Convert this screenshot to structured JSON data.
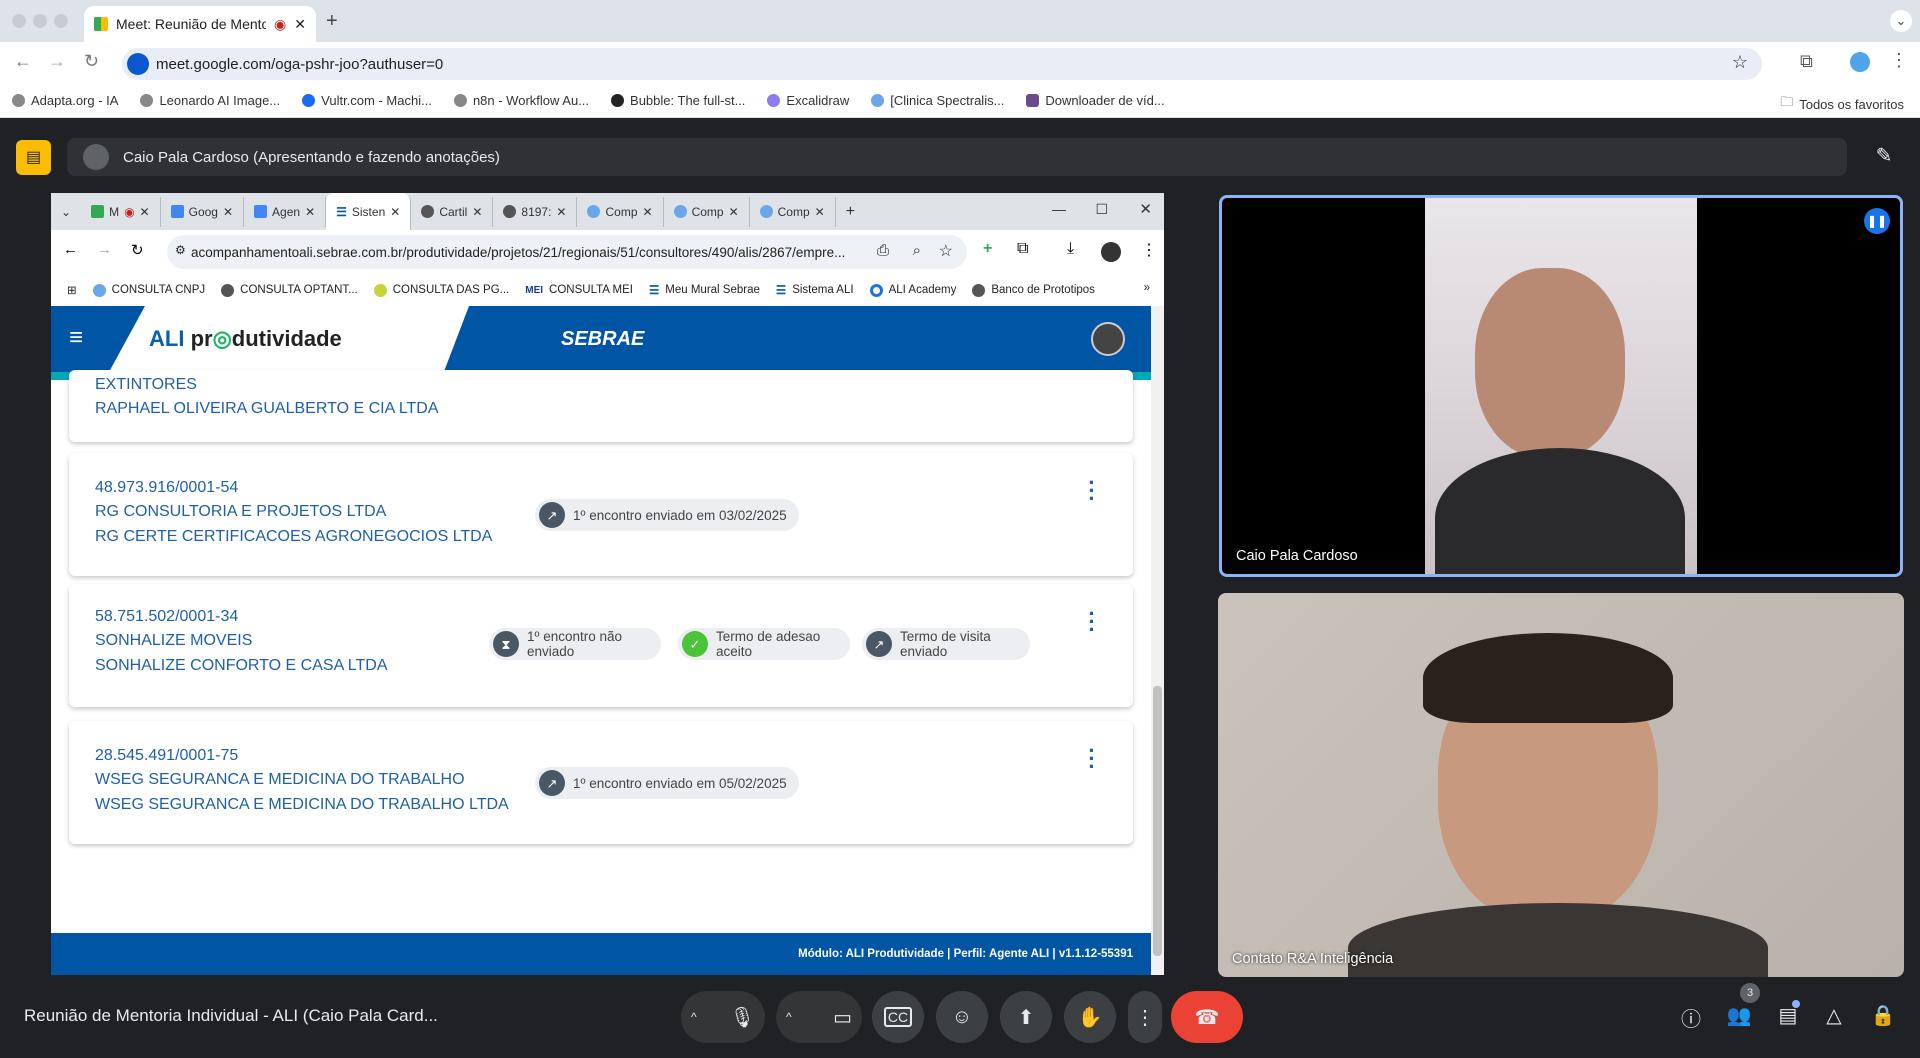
{
  "browser": {
    "tab_title": "Meet: Reunião de Mentori",
    "url": "meet.google.com/oga-pshr-joo?authuser=0",
    "bookmarks": [
      "Adapta.org - IA",
      "Leonardo AI Image...",
      "Vultr.com - Machi...",
      "n8n - Workflow Au...",
      "Bubble: The full-st...",
      "Excalidraw",
      "[Clinica Spectralis...",
      "Downloader de víd..."
    ],
    "all_bookmarks": "Todos os favoritos"
  },
  "meet": {
    "presenter_banner": "Caio Pala Cardoso (Apresentando e fazendo anotações)",
    "meeting_title": "Reunião de Mentoria Individual - ALI (Caio Pala Card...",
    "participants": [
      {
        "name": "Caio Pala Cardoso"
      },
      {
        "name": "Contato R&A Inteligência"
      }
    ],
    "people_count": "3",
    "accent": "#8ab4f8",
    "end_call_color": "#ea4335"
  },
  "shared": {
    "tabs": [
      "M",
      "Goog",
      "Agen",
      "Sisten",
      "Cartil",
      "8197:",
      "Comp",
      "Comp",
      "Comp"
    ],
    "url": "acompanhamentoali.sebrae.com.br/produtividade/projetos/21/regionais/51/consultores/490/alis/2867/empre...",
    "bookmarks": [
      "CONSULTA CNPJ",
      "CONSULTA OPTANT...",
      "CONSULTA DAS PG...",
      "CONSULTA MEI",
      "Meu Mural Sebrae",
      "Sistema ALI",
      "ALI Academy",
      "Banco de Prototipos"
    ],
    "app": {
      "logo_ali": "ALI",
      "logo_rest": "pr",
      "logo_tail": "dutividade",
      "sebrae": "SEBRAE"
    },
    "cards": [
      {
        "line0": "EXTINTORES",
        "line2": "RAPHAEL OLIVEIRA GUALBERTO E CIA LTDA"
      },
      {
        "cnpj": "48.973.916/0001-54",
        "fantasia": "RG CONSULTORIA E PROJETOS LTDA",
        "razao": "RG CERTE CERTIFICACOES AGRONEGOCIOS LTDA",
        "badges": [
          {
            "icon": "arrow-up-right",
            "text": "1º encontro enviado em 03/02/2025"
          }
        ]
      },
      {
        "cnpj": "58.751.502/0001-34",
        "fantasia": "SONHALIZE MOVEIS",
        "razao": "SONHALIZE CONFORTO E CASA LTDA",
        "badges": [
          {
            "icon": "hourglass",
            "text": "1º encontro não enviado"
          },
          {
            "icon": "check",
            "text": "Termo de adesao aceito"
          },
          {
            "icon": "arrow-up-right",
            "text": "Termo de visita enviado"
          }
        ]
      },
      {
        "cnpj": "28.545.491/0001-75",
        "fantasia": "WSEG SEGURANCA E MEDICINA DO TRABALHO",
        "razao": "WSEG SEGURANCA E MEDICINA DO TRABALHO LTDA",
        "badges": [
          {
            "icon": "arrow-up-right",
            "text": "1º encontro enviado em 05/02/2025"
          }
        ]
      }
    ],
    "footer": "Módulo: ALI Produtividade | Perfil: Agente ALI | v1.1.12-55391",
    "brand_blue": "#0055a4",
    "teal": "#00aab4",
    "success": "#4cc23a"
  }
}
